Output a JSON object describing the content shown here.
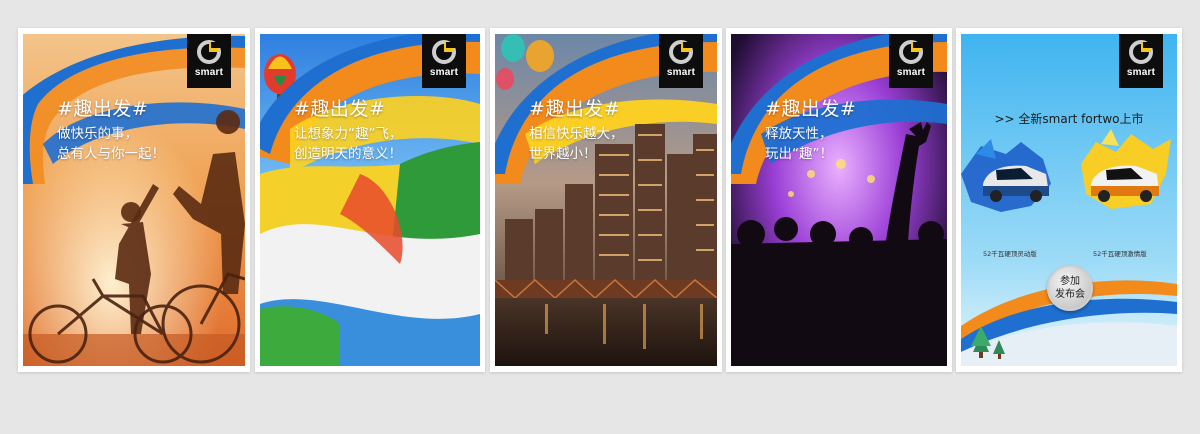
{
  "brand": {
    "logo_text": "smart"
  },
  "posters": [
    {
      "hashtag": "#趣出发#",
      "line1": "做快乐的事，",
      "line2": "总有人与你一起！"
    },
    {
      "hashtag": "#趣出发#",
      "line1": "让想象力“趣”飞，",
      "line2": "创造明天的意义！"
    },
    {
      "hashtag": "#趣出发#",
      "line1": "相信快乐越大，",
      "line2": "世界越小！"
    },
    {
      "hashtag": "#趣出发#",
      "line1": "释放天性，",
      "line2": "玩出“趣”！"
    },
    {
      "headline": ">> 全新smart fortwo上市",
      "car_left_caption": "52千瓦硬顶灵动版",
      "car_right_caption": "52千瓦硬顶激情版",
      "join_button_line1": "参加",
      "join_button_line2": "发布会"
    }
  ],
  "colors": {
    "page_bg": "#e6e6e6",
    "swoosh_blue": "#1f6fd1",
    "swoosh_orange": "#f28a1c",
    "swoosh_yellow": "#ffd21f",
    "logo_bg": "#0d0d0d"
  }
}
